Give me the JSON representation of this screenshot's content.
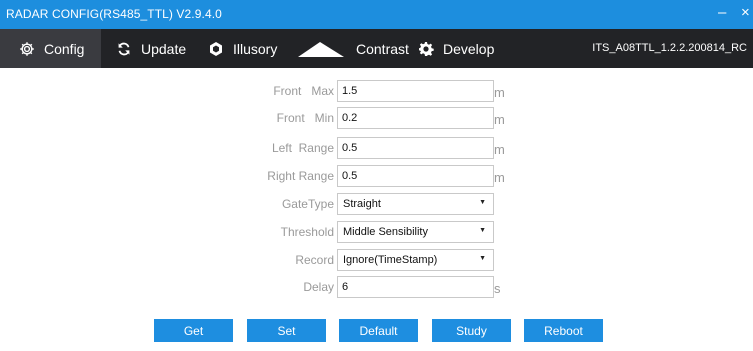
{
  "window": {
    "title": "RADAR CONFIG(RS485_TTL) V2.9.4.0",
    "minimize_label": "–",
    "close_label": "×"
  },
  "menu": {
    "tabs": [
      {
        "label": "Config",
        "icon": "gear-icon",
        "active": true
      },
      {
        "label": "Update",
        "icon": "refresh-icon",
        "active": false
      },
      {
        "label": "Illusory",
        "icon": "hexagon-icon",
        "active": false
      },
      {
        "label": "Contrast",
        "icon": "mountain-icon",
        "active": false
      },
      {
        "label": "Develop",
        "icon": "settings-icon",
        "active": false
      }
    ],
    "version": "ITS_A08TTL_1.2.2.200814_RC"
  },
  "form": {
    "front_max": {
      "label": "Front   Max",
      "value": "1.5",
      "unit": "m"
    },
    "front_min": {
      "label": "Front   Min",
      "value": "0.2",
      "unit": "m"
    },
    "left_range": {
      "label": "Left  Range",
      "value": "0.5",
      "unit": "m"
    },
    "right_range": {
      "label": "Right Range",
      "value": "0.5",
      "unit": "m"
    },
    "gate_type": {
      "label": "GateType",
      "value": "Straight"
    },
    "threshold": {
      "label": "Threshold",
      "value": "Middle Sensibility"
    },
    "record": {
      "label": "Record",
      "value": "Ignore(TimeStamp)"
    },
    "delay": {
      "label": "Delay",
      "value": "6",
      "unit": "s"
    }
  },
  "buttons": {
    "get": "Get",
    "set": "Set",
    "default": "Default",
    "study": "Study",
    "reboot": "Reboot"
  },
  "colors": {
    "titlebar": "#1d8ede",
    "menubar": "#222326",
    "active_tab": "#3a3b40",
    "button": "#1e8ee0",
    "label": "#9a9a9a"
  }
}
